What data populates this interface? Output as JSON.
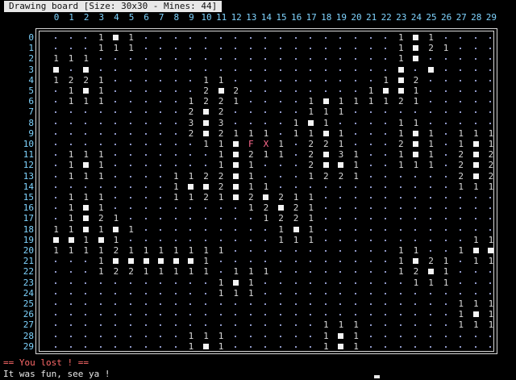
{
  "title": "Drawing board [Size: 30x30 - Mines: 44]",
  "columns": [
    "0",
    "1",
    "2",
    "3",
    "4",
    "5",
    "6",
    "7",
    "8",
    "9",
    "10",
    "11",
    "12",
    "13",
    "14",
    "15",
    "16",
    "17",
    "18",
    "19",
    "20",
    "21",
    "22",
    "23",
    "24",
    "25",
    "26",
    "27",
    "28",
    "29"
  ],
  "rows_labels": [
    "0",
    "1",
    "2",
    "3",
    "4",
    "5",
    "6",
    "7",
    "8",
    "9",
    "10",
    "11",
    "12",
    "13",
    "14",
    "15",
    "16",
    "17",
    "18",
    "19",
    "20",
    "21",
    "22",
    "23",
    "24",
    "25",
    "26",
    "27",
    "28",
    "29"
  ],
  "legend": {
    ".": "revealed-empty",
    "#": "unrevealed",
    "F": "flag",
    "X": "exploded-mine",
    "1-9": "adjacent-mine-count"
  },
  "grid": [
    "...1#1.................1#1....",
    "...111.................1#21...",
    "111....................1#.....",
    "#.#....................#.#....",
    "1221......11..........1#2.....",
    ".1#1......2#2........1##1.....",
    ".111.....1221....1#111121.....",
    ".........2#2.....111..........",
    ".........3#3....1#1....11.....",
    ".........2#2111.11#1...1#1.111",
    "..........11#FX1.221...2#1.1#1",
    ".111.......1#211.2#31..1#1.2#2",
    ".1#1.......1#1...2##1..111.2#2",
    ".111....1122#1...1221......2#2",
    "........1##2#11............111",
    ".111....1121#2#211............",
    ".1#1.........12#21............",
    ".1#21.........1221............",
    "11#1#1.........1#1............",
    "##1#1..........111..........111",
    "111121111111...........11..1##",
    "...1######1............1#21.111",
    "...12211111.111........12#1...",
    "...........1#1..........111...",
    "...........111................",
    "...........................111",
    "...........................1#1",
    "..................111......111",
    ".........111......1#1.........",
    ".........1#1......1#1........."
  ],
  "status": {
    "lost": "== You lost ! ==",
    "bye": "It was fun, see ya !"
  },
  "colors": {
    "background": "#000000",
    "header_numbers": "#7fd4ff",
    "dot": "#8f98c8",
    "text": "#d8d8d8",
    "alert": "#ff6a8e"
  }
}
